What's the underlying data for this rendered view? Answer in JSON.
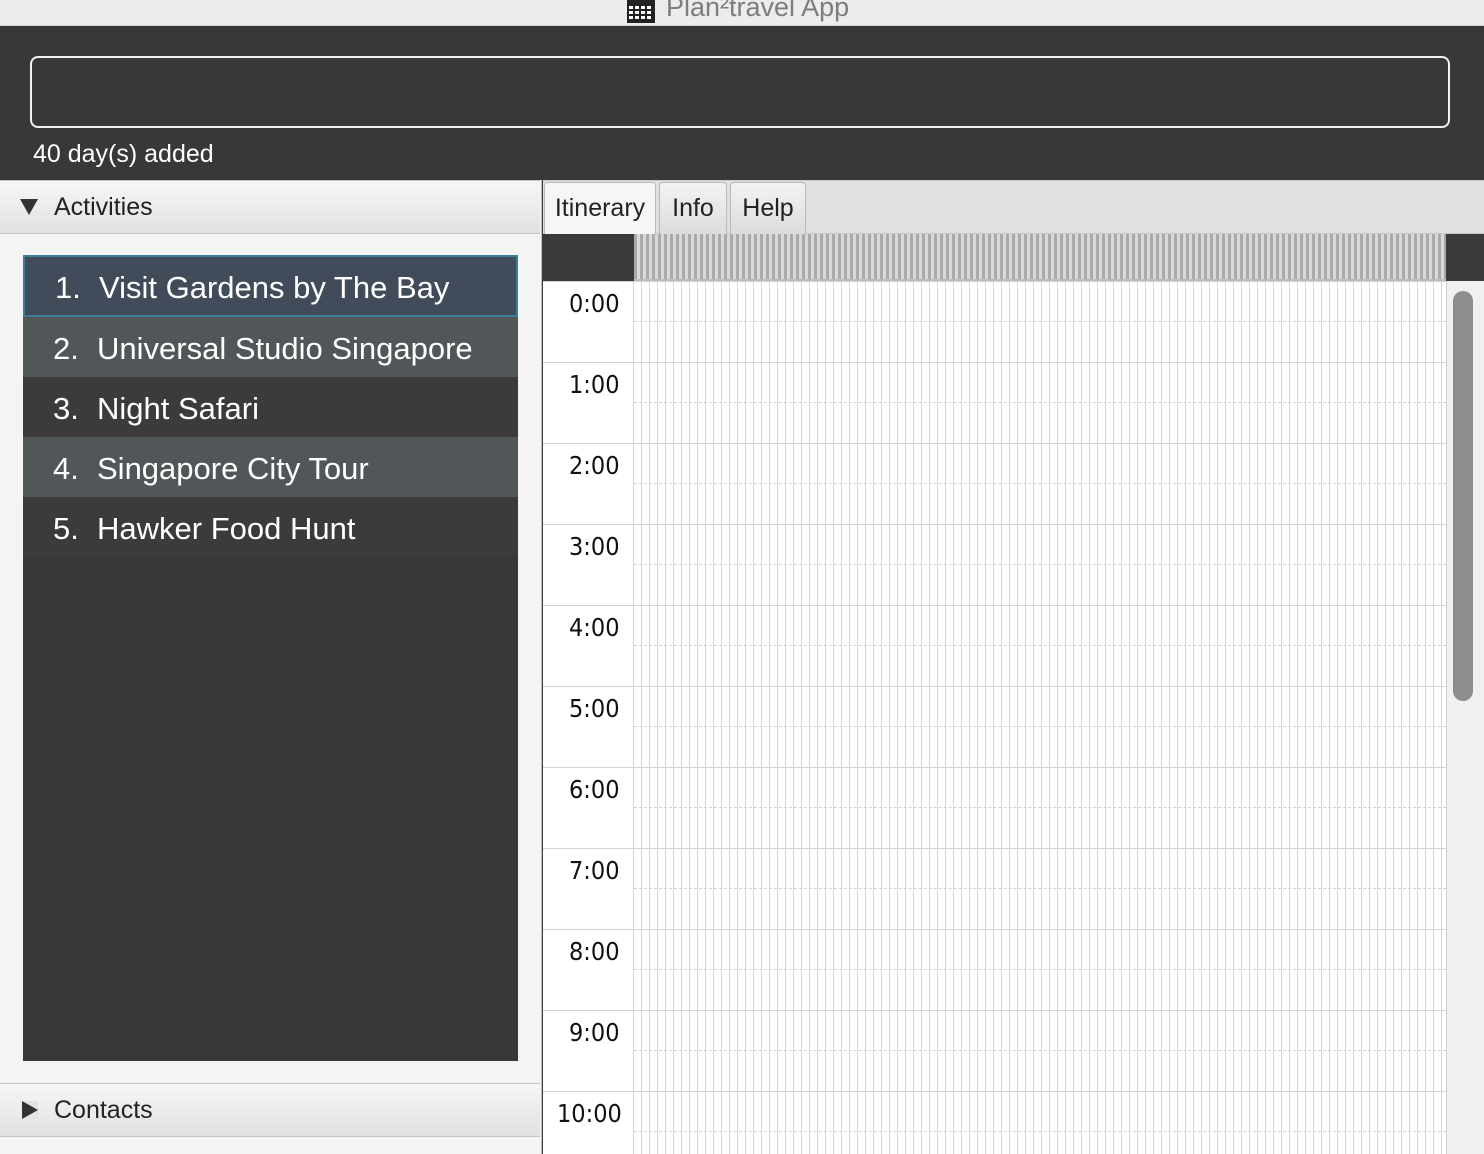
{
  "window": {
    "title": "Plan²travel App",
    "icon": "calendar-icon"
  },
  "command": {
    "value": "",
    "placeholder": ""
  },
  "result": {
    "message": "40 day(s) added"
  },
  "panels": {
    "activities": {
      "title": "Activities",
      "expanded": true
    },
    "contacts": {
      "title": "Contacts",
      "expanded": false
    }
  },
  "activities": [
    {
      "index": "1.",
      "name": "Visit Gardens by The Bay",
      "selected": true
    },
    {
      "index": "2.",
      "name": "Universal Studio Singapore"
    },
    {
      "index": "3.",
      "name": "Night Safari"
    },
    {
      "index": "4.",
      "name": "Singapore City Tour"
    },
    {
      "index": "5.",
      "name": "Hawker Food Hunt"
    }
  ],
  "tabs": [
    {
      "label": "Itinerary",
      "active": true
    },
    {
      "label": "Info"
    },
    {
      "label": "Help"
    }
  ],
  "calendar": {
    "times": [
      "0:00",
      "1:00",
      "2:00",
      "3:00",
      "4:00",
      "5:00",
      "6:00",
      "7:00",
      "8:00",
      "9:00",
      "10:00"
    ]
  },
  "colors": {
    "dark_bg": "#383838",
    "selection": "#414b5a",
    "selection_border": "#3a7f96"
  }
}
